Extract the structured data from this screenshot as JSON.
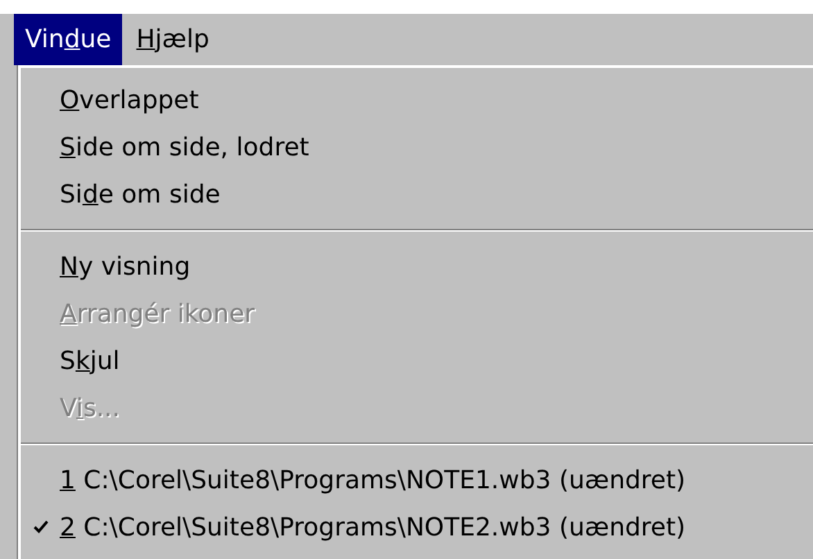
{
  "menu_bar": [
    {
      "label_start": "Vin",
      "access_key": "d",
      "label_end": "ue",
      "selected": true
    },
    {
      "access_key": "H",
      "label_end": "jælp",
      "selected": false
    }
  ],
  "menu": {
    "items": [
      {
        "kind": "item",
        "access_key": "O",
        "label_end": "verlappet",
        "disabled": false,
        "checked": false
      },
      {
        "kind": "item",
        "access_key": "S",
        "label_end": "ide om side, lodret",
        "disabled": false,
        "checked": false
      },
      {
        "kind": "item",
        "label_start": "Si",
        "access_key": "d",
        "label_end": "e om side",
        "disabled": false,
        "checked": false
      },
      {
        "kind": "separator"
      },
      {
        "kind": "item",
        "access_key": "N",
        "label_end": "y visning",
        "disabled": false,
        "checked": false
      },
      {
        "kind": "item",
        "access_key": "A",
        "label_end": "rrangér ikoner",
        "disabled": true,
        "checked": false
      },
      {
        "kind": "item",
        "label_start": "S",
        "access_key": "k",
        "label_end": "jul",
        "disabled": false,
        "checked": false
      },
      {
        "kind": "item",
        "label_start": "V",
        "access_key": "i",
        "label_end": "s...",
        "disabled": true,
        "checked": false
      },
      {
        "kind": "separator"
      },
      {
        "kind": "item",
        "access_key": "1",
        "label_end": " C:\\Corel\\Suite8\\Programs\\NOTE1.wb3 (uændret)",
        "disabled": false,
        "checked": false
      },
      {
        "kind": "item",
        "access_key": "2",
        "label_end": " C:\\Corel\\Suite8\\Programs\\NOTE2.wb3 (uændret)",
        "disabled": false,
        "checked": true
      }
    ]
  }
}
